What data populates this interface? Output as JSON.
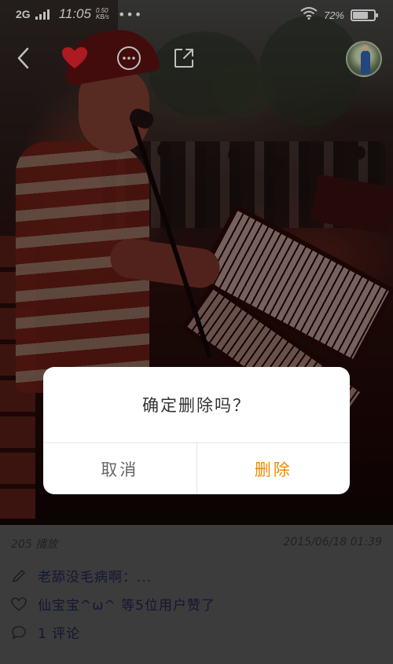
{
  "status_bar": {
    "network": "2G",
    "time": "11:05",
    "speed_value": "0.50",
    "speed_unit": "KB/s",
    "more": "•••",
    "battery_pct": "72%",
    "battery_level": 0.72
  },
  "topbar": {
    "back_icon": "chevron-left-icon",
    "like_icon": "heart-icon",
    "more_icon": "more-dots-icon",
    "share_icon": "share-icon"
  },
  "dialog": {
    "message": "确定删除吗？",
    "cancel_label": "取消",
    "delete_label": "删除"
  },
  "post": {
    "plays": "205 播放",
    "date": "2015/06/18 01:39",
    "caption": "老舔没毛病啊：...",
    "likes": "仙宝宝^ω^ 等5位用户赞了",
    "comments": "1 评论"
  },
  "colors": {
    "accent": "#f08a00",
    "info_bg": "#505050",
    "dialog_bg": "#ffffff"
  }
}
